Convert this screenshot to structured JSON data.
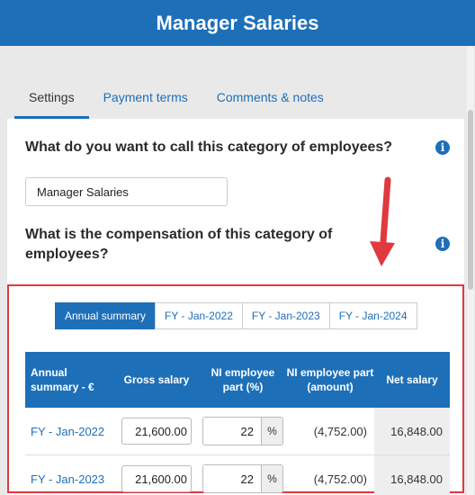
{
  "header": {
    "title": "Manager Salaries"
  },
  "tabs": [
    {
      "label": "Settings",
      "active": true
    },
    {
      "label": "Payment terms",
      "active": false
    },
    {
      "label": "Comments & notes",
      "active": false
    }
  ],
  "settings": {
    "question_name": "What do you want to call this category of employees?",
    "name_value": "Manager Salaries",
    "question_compensation": "What is the compensation of this category of employees?",
    "info_icon_glyph": "i"
  },
  "subtabs": [
    {
      "label": "Annual summary",
      "active": true
    },
    {
      "label": "FY - Jan-2022",
      "active": false
    },
    {
      "label": "FY - Jan-2023",
      "active": false
    },
    {
      "label": "FY - Jan-2024",
      "active": false
    }
  ],
  "grid": {
    "headers": {
      "period": "Annual summary - €",
      "gross": "Gross salary",
      "ni_pct": "NI employee part (%)",
      "ni_amount": "NI employee part (amount)",
      "net": "Net salary"
    },
    "rows": [
      {
        "period": "FY - Jan-2022",
        "gross": "21,600.00",
        "ni_pct": "22",
        "ni_unit": "%",
        "ni_amount": "(4,752.00)",
        "net": "16,848.00"
      },
      {
        "period": "FY - Jan-2023",
        "gross": "21,600.00",
        "ni_pct": "22",
        "ni_unit": "%",
        "ni_amount": "(4,752.00)",
        "net": "16,848.00"
      }
    ]
  },
  "colors": {
    "brand": "#1d6fb8",
    "highlight": "#e0393e"
  }
}
